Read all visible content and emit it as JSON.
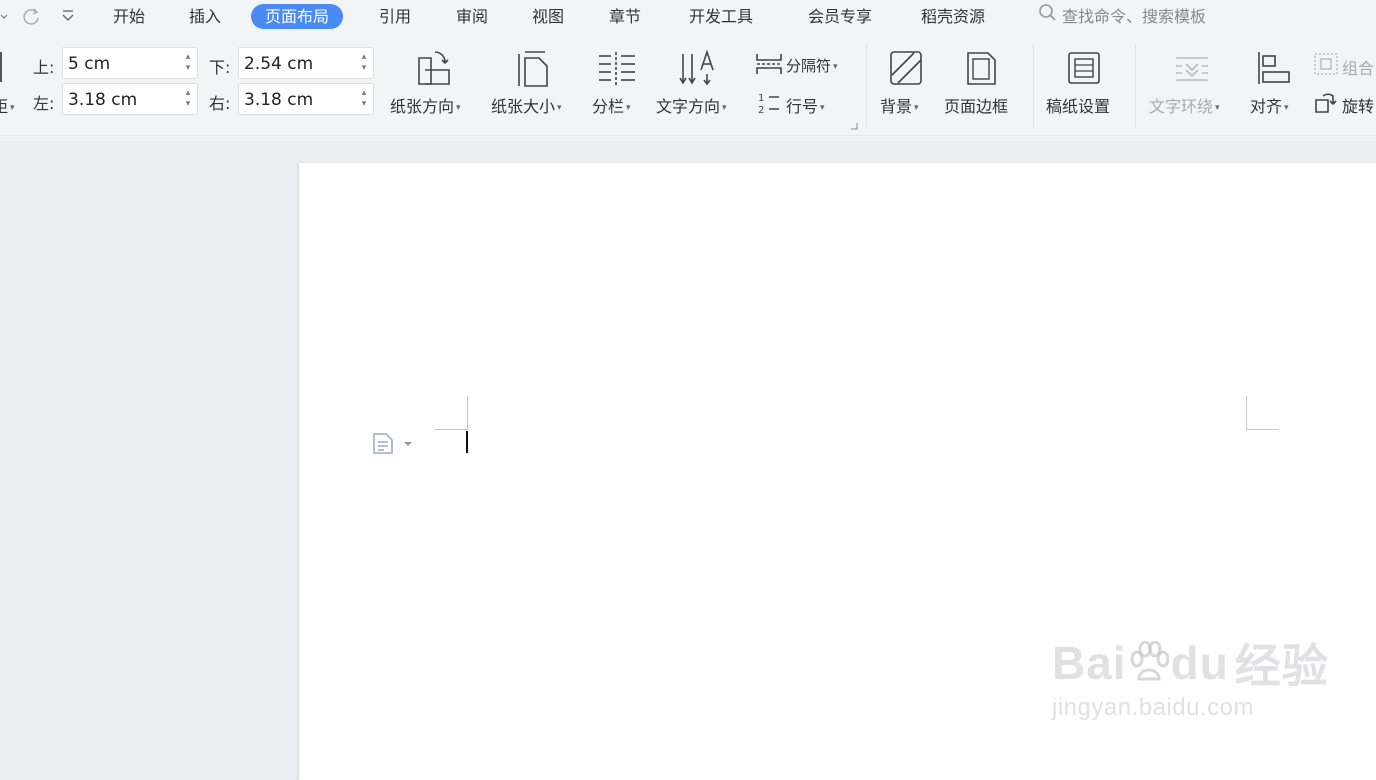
{
  "tabs": [
    {
      "label": "开始"
    },
    {
      "label": "插入"
    },
    {
      "label": "页面布局",
      "active": true
    },
    {
      "label": "引用"
    },
    {
      "label": "审阅"
    },
    {
      "label": "视图"
    },
    {
      "label": "章节"
    },
    {
      "label": "开发工具"
    },
    {
      "label": "会员专享"
    },
    {
      "label": "稻壳资源"
    }
  ],
  "search": {
    "placeholder": "查找命令、搜索模板",
    "icon": "search-icon"
  },
  "margins": {
    "top_label": "上:",
    "top_value": "5 cm",
    "bottom_label": "下:",
    "bottom_value": "2.54 cm",
    "left_label": "左:",
    "left_value": "3.18 cm",
    "right_label": "右:",
    "right_value": "3.18 cm",
    "partial_label": "距"
  },
  "ribbon": {
    "orientation": "纸张方向",
    "size": "纸张大小",
    "columns": "分栏",
    "text_direction": "文字方向",
    "breaks": "分隔符",
    "line_numbers": "行号",
    "background": "背景",
    "page_border": "页面边框",
    "manuscript": "稿纸设置",
    "text_wrap": "文字环绕",
    "align": "对齐",
    "group": "组合",
    "rotate": "旋转"
  },
  "watermark": {
    "brand": "Bai",
    "brand2": "du",
    "brand_cn": "经验",
    "url": "jingyan.baidu.com"
  },
  "colors": {
    "accent": "#4a8af4"
  }
}
